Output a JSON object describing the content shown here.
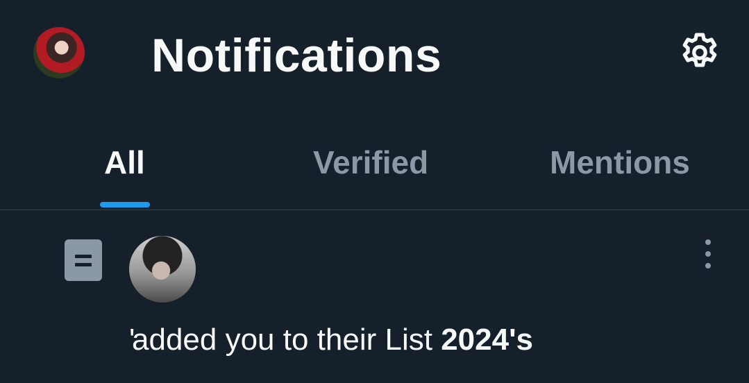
{
  "header": {
    "title": "Notifications",
    "settings_icon": "gear-icon",
    "avatar_alt": "profile avatar"
  },
  "tabs": [
    {
      "label": "All",
      "active": true
    },
    {
      "label": "Verified",
      "active": false
    },
    {
      "label": "Mentions",
      "active": false
    }
  ],
  "colors": {
    "background": "#15202b",
    "accent": "#1d9bf0",
    "text_primary": "#f7f9f9",
    "text_secondary": "#8b98a5",
    "divider": "#38444d"
  },
  "notification": {
    "type_icon": "list-icon",
    "actor_name": "'",
    "action_text": "added you to their List ",
    "list_name": "2024's",
    "more_icon": "more-vertical-icon"
  }
}
